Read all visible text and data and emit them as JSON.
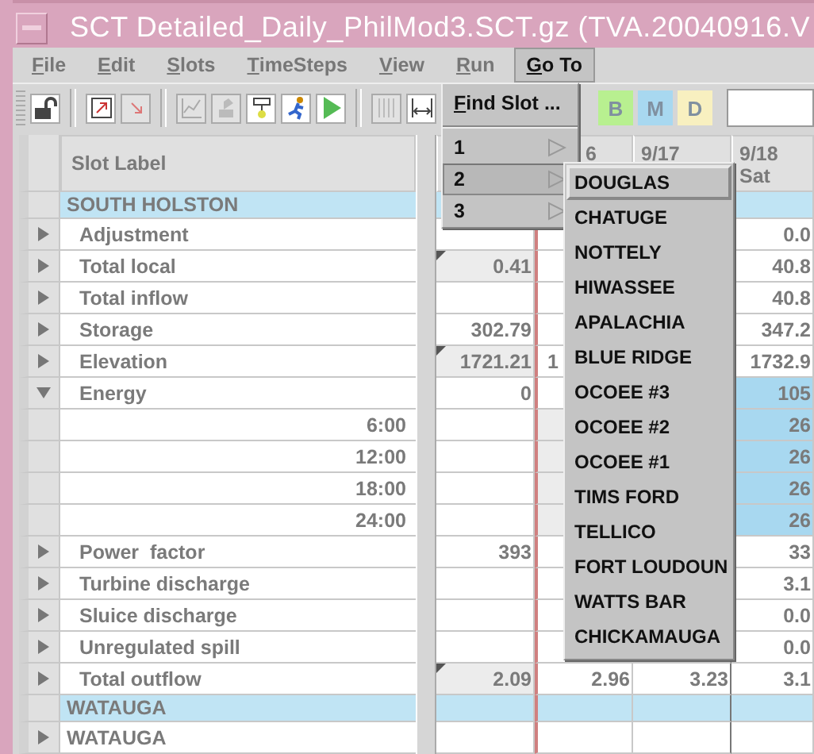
{
  "window": {
    "title": "SCT Detailed_Daily_PhilMod3.SCT.gz (TVA.20040916.V"
  },
  "menu_bar": [
    {
      "label": "File",
      "selected": false
    },
    {
      "label": "Edit",
      "selected": false
    },
    {
      "label": "Slots",
      "selected": false
    },
    {
      "label": "TimeSteps",
      "selected": false
    },
    {
      "label": "View",
      "selected": false
    },
    {
      "label": "Run",
      "selected": false
    },
    {
      "label": "Go To",
      "selected": true
    }
  ],
  "toolbar": {
    "letter_buttons": [
      {
        "label": "B",
        "color": "#b8f090"
      },
      {
        "label": "M",
        "color": "#a8d8f0"
      },
      {
        "label": "D",
        "color": "#f8f0c0"
      }
    ]
  },
  "goto_menu": [
    {
      "label": "Find Slot ...",
      "kind": "command",
      "selected": false
    },
    {
      "label": "1",
      "kind": "submenu",
      "selected": false
    },
    {
      "label": "2",
      "kind": "submenu",
      "selected": true
    },
    {
      "label": "3",
      "kind": "submenu",
      "selected": false
    }
  ],
  "submenu": [
    {
      "label": "DOUGLAS",
      "selected": true
    },
    {
      "label": "CHATUGE",
      "selected": false
    },
    {
      "label": "NOTTELY",
      "selected": false
    },
    {
      "label": "HIWASSEE",
      "selected": false
    },
    {
      "label": "APALACHIA",
      "selected": false
    },
    {
      "label": "BLUE RIDGE",
      "selected": false
    },
    {
      "label": "OCOEE #3",
      "selected": false
    },
    {
      "label": "OCOEE #2",
      "selected": false
    },
    {
      "label": "OCOEE #1",
      "selected": false
    },
    {
      "label": "TIMS FORD",
      "selected": false
    },
    {
      "label": "TELLICO",
      "selected": false
    },
    {
      "label": "FORT LOUDOUN",
      "selected": false
    },
    {
      "label": "WATTS BAR",
      "selected": false
    },
    {
      "label": "CHICKAMAUGA",
      "selected": false
    }
  ],
  "table": {
    "label_header": "Slot Label",
    "columns": [
      {
        "kind": "covered"
      },
      {
        "kind": "date",
        "label": "6"
      },
      {
        "kind": "date",
        "label": "9/17"
      },
      {
        "kind": "date",
        "label": "9/18",
        "sublabel": "Sat"
      }
    ],
    "rows": [
      {
        "kind": "group",
        "label": "SOUTH HOLSTON"
      },
      {
        "kind": "slot",
        "label": "Adjustment",
        "expanded": false,
        "cells": [
          null,
          null,
          null,
          {
            "text": "0.0"
          }
        ]
      },
      {
        "kind": "slot",
        "label": "Total local",
        "expanded": false,
        "cells": [
          {
            "text": "0.41",
            "flagged": true
          },
          null,
          null,
          {
            "text": "40.8"
          }
        ]
      },
      {
        "kind": "slot",
        "label": "Total inflow",
        "expanded": false,
        "cells": [
          null,
          null,
          null,
          {
            "text": "40.8"
          }
        ]
      },
      {
        "kind": "slot",
        "label": "Storage",
        "expanded": false,
        "cells": [
          {
            "text": "302.79"
          },
          null,
          null,
          {
            "text": "347.2"
          }
        ]
      },
      {
        "kind": "slot",
        "label": "Elevation",
        "expanded": false,
        "cells": [
          {
            "text": "1721.21",
            "flagged": true
          },
          {
            "text": "1",
            "overlapped": true
          },
          null,
          {
            "text": "1732.9"
          }
        ]
      },
      {
        "kind": "slot",
        "label": "Energy",
        "expanded": true,
        "cells": [
          {
            "text": "0"
          },
          null,
          null,
          {
            "text": "105",
            "selected": true
          }
        ]
      },
      {
        "kind": "timestep",
        "label": "6:00",
        "cells": [
          null,
          {
            "shaded": true
          },
          null,
          {
            "text": "26",
            "selected": true
          }
        ]
      },
      {
        "kind": "timestep",
        "label": "12:00",
        "cells": [
          null,
          {
            "shaded": true
          },
          null,
          {
            "text": "26",
            "selected": true
          }
        ]
      },
      {
        "kind": "timestep",
        "label": "18:00",
        "cells": [
          null,
          {
            "shaded": true
          },
          null,
          {
            "text": "26",
            "selected": true
          }
        ]
      },
      {
        "kind": "timestep",
        "label": "24:00",
        "cells": [
          null,
          {
            "shaded": true
          },
          null,
          {
            "text": "26",
            "selected": true
          }
        ]
      },
      {
        "kind": "slot",
        "label": "Power  factor",
        "expanded": false,
        "cells": [
          {
            "text": "393"
          },
          null,
          null,
          {
            "text": "33"
          }
        ]
      },
      {
        "kind": "slot",
        "label": "Turbine discharge",
        "expanded": false,
        "cells": [
          null,
          null,
          null,
          {
            "text": "3.1"
          }
        ]
      },
      {
        "kind": "slot",
        "label": "Sluice discharge",
        "expanded": false,
        "cells": [
          null,
          null,
          null,
          {
            "text": "0.0"
          }
        ]
      },
      {
        "kind": "slot",
        "label": "Unregulated spill",
        "expanded": false,
        "cells": [
          null,
          null,
          null,
          {
            "text": "0.0"
          }
        ]
      },
      {
        "kind": "slot",
        "label": "Total outflow",
        "expanded": false,
        "cells": [
          {
            "text": "2.09",
            "flagged": true
          },
          {
            "text": "2.96"
          },
          {
            "text": "3.23"
          },
          {
            "text": "3.1"
          }
        ]
      },
      {
        "kind": "group",
        "label": "WATAUGA"
      },
      {
        "kind": "object",
        "label": "WATAUGA",
        "expanded": false,
        "cells": [
          null,
          null,
          null,
          null
        ]
      }
    ]
  }
}
